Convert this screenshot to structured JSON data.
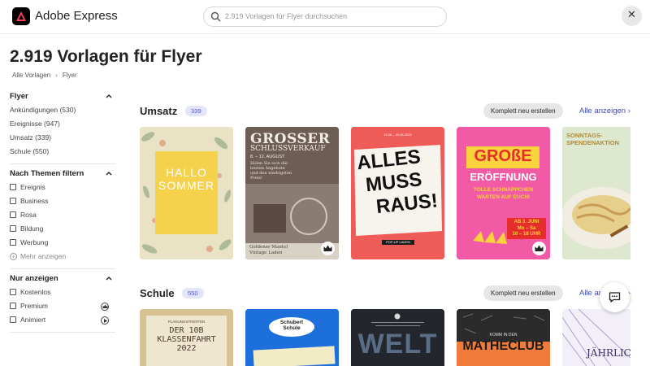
{
  "app": {
    "name": "Adobe Express"
  },
  "search": {
    "placeholder": "2.919 Vorlagen für Flyer durchsuchen"
  },
  "page": {
    "title": "2.919 Vorlagen für Flyer"
  },
  "breadcrumb": {
    "items": [
      "Alle Vorlagen",
      "Flyer"
    ]
  },
  "sidebar": {
    "flyer": {
      "heading": "Flyer",
      "items": [
        "Ankündigungen (530)",
        "Ereignisse (947)",
        "Umsatz (339)",
        "Schule (550)"
      ]
    },
    "themes": {
      "heading": "Nach Themen filtern",
      "items": [
        "Ereignis",
        "Business",
        "Rosa",
        "Bildung",
        "Werbung"
      ],
      "more": "Mehr anzeigen"
    },
    "only": {
      "heading": "Nur anzeigen",
      "items": [
        "Kostenlos",
        "Premium",
        "Animiert"
      ]
    }
  },
  "sections": [
    {
      "title": "Umsatz",
      "count": "339",
      "remix_label": "Komplett neu erstellen",
      "see_all": "Alle anzeigen",
      "cards": [
        {
          "lines": [
            "HALLO",
            "SOMMER"
          ],
          "premium": false
        },
        {
          "lines": [
            "GROSSER",
            "SCHLUSSVERKAUF",
            "8. – 12. AUGUST",
            "Holen Sie sich die",
            "besten Angebote",
            "und den niedrigsten",
            "Preis!",
            "Goldener Mantel",
            "Vintage Laden"
          ],
          "premium": true
        },
        {
          "lines": [
            "ALLES",
            "MUSS",
            "RAUS!",
            "POP-UP LADEN"
          ],
          "premium": false
        },
        {
          "lines": [
            "GROßE",
            "ERÖFFNUNG",
            "TOLLE SCHNÄPPCHEN",
            "WARTEN AUF EUCH!",
            "AB 3. JUNI",
            "Mo – Sa",
            "10 – 18 UHR"
          ],
          "premium": true
        },
        {
          "lines": [
            "SONNTAGS-",
            "SPENDENAKTION"
          ],
          "premium": false
        }
      ]
    },
    {
      "title": "Schule",
      "count": "550",
      "remix_label": "Komplett neu erstellen",
      "see_all": "Alle anzeigen",
      "cards": [
        {
          "lines": [
            "PLANUNGSTREFFEN",
            "DER 10B",
            "KLASSENFAHRT",
            "2022"
          ]
        },
        {
          "lines": [
            "Schubert",
            "Schule"
          ]
        },
        {
          "lines": [
            "WELT"
          ]
        },
        {
          "lines": [
            "KOMM IN DEN",
            "MATHECLUB"
          ]
        },
        {
          "lines": [
            "JÄHRLICHE"
          ]
        }
      ]
    }
  ],
  "colors": {
    "accent": "#3b47c5",
    "count_bg": "#e4e4fb",
    "count_text": "#5257c9"
  },
  "icons": [
    "adobe-express-logo",
    "search-icon",
    "close-icon",
    "chevron-up-icon",
    "chevron-right-icon",
    "crown-icon",
    "play-icon",
    "chat-icon"
  ]
}
